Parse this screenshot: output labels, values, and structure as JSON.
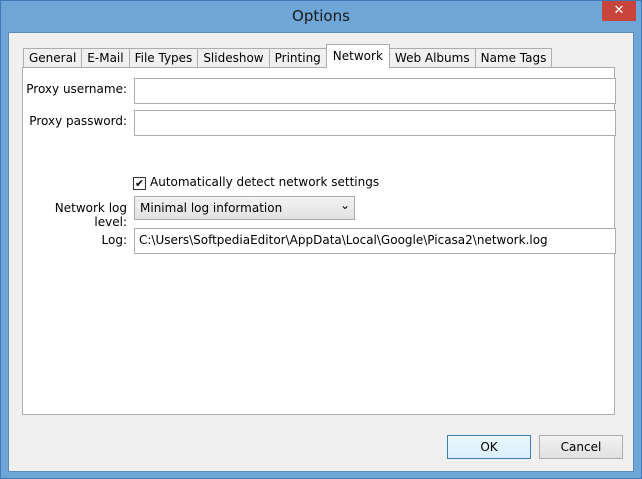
{
  "window": {
    "title": "Options",
    "close_glyph": "✕"
  },
  "tabs": [
    "General",
    "E-Mail",
    "File Types",
    "Slideshow",
    "Printing",
    "Network",
    "Web Albums",
    "Name Tags"
  ],
  "active_tab": "Network",
  "network": {
    "proxy_username_label": "Proxy username:",
    "proxy_username_value": "",
    "proxy_password_label": "Proxy password:",
    "proxy_password_value": "",
    "auto_detect_label": "Automatically detect network settings",
    "auto_detect_checked": true,
    "log_level_label": "Network log level:",
    "log_level_value": "Minimal log information",
    "log_label": "Log:",
    "log_path": "C:\\Users\\SoftpediaEditor\\AppData\\Local\\Google\\Picasa2\\network.log"
  },
  "buttons": {
    "ok": "OK",
    "cancel": "Cancel"
  }
}
